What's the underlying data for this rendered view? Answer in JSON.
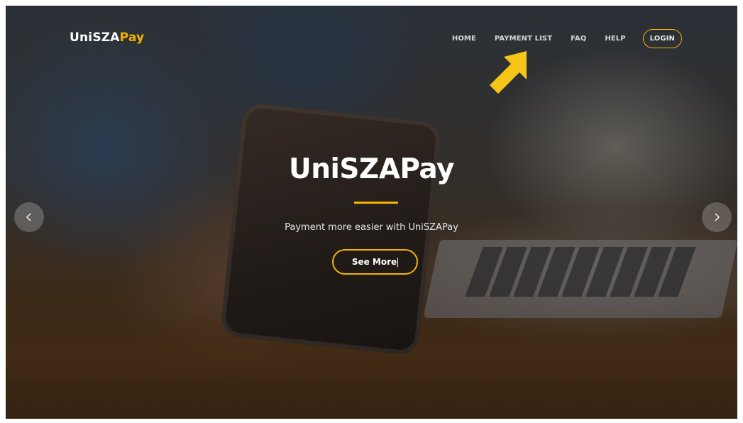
{
  "brand": {
    "name_part1": "UniSZA",
    "name_part2": "Pay",
    "accent_color": "#f5b400"
  },
  "nav": {
    "items": [
      {
        "label": "HOME"
      },
      {
        "label": "PAYMENT LIST"
      },
      {
        "label": "FAQ"
      },
      {
        "label": "HELP"
      }
    ],
    "login_label": "LOGIN"
  },
  "hero": {
    "title": "UniSZAPay",
    "subtitle": "Payment more easier with UniSZAPay",
    "cta_label": "See More"
  },
  "carousel": {
    "prev_icon": "chevron-left-icon",
    "next_icon": "chevron-right-icon"
  },
  "annotation": {
    "icon": "arrow-pointer-icon",
    "color": "#f5c518"
  }
}
